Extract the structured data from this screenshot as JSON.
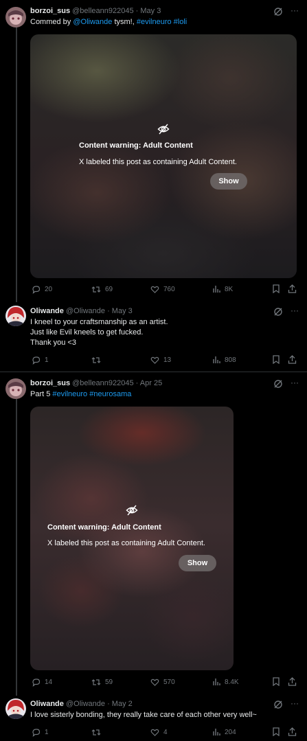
{
  "posts": [
    {
      "display_name": "borzoi_sus",
      "handle": "@belleann922045",
      "date": "· May 3",
      "text_prefix": "Commed by ",
      "mention": "@Oliwande",
      "text_mid": " tysm!, ",
      "tags": "#evilneuro #loli",
      "content_warning": {
        "title": "Content warning: Adult Content",
        "description": "X labeled this post as containing Adult Content.",
        "show_label": "Show"
      },
      "stats": {
        "replies": "20",
        "reposts": "69",
        "likes": "760",
        "views": "8K"
      }
    },
    {
      "display_name": "Oliwande",
      "handle": "@Oliwande",
      "date": "· May 3",
      "lines": [
        "I kneel to your craftsmanship as an artist.",
        "Just like Evil kneels to get fucked.",
        "Thank you <3"
      ],
      "stats": {
        "replies": "1",
        "reposts": "",
        "likes": "13",
        "views": "808"
      }
    },
    {
      "display_name": "borzoi_sus",
      "handle": "@belleann922045",
      "date": "· Apr 25",
      "text_prefix": "Part 5 ",
      "tags": "#evilneuro #neurosama",
      "content_warning": {
        "title": "Content warning: Adult Content",
        "description": "X labeled this post as containing Adult Content.",
        "show_label": "Show"
      },
      "stats": {
        "replies": "14",
        "reposts": "59",
        "likes": "570",
        "views": "8.4K"
      }
    },
    {
      "display_name": "Oliwande",
      "handle": "@Oliwande",
      "date": "· May 2",
      "text": "I love sisterly bonding, they really take care of each other very well~",
      "stats": {
        "replies": "1",
        "reposts": "",
        "likes": "4",
        "views": "204"
      }
    }
  ],
  "colors": {
    "link": "#1d9bf0",
    "muted": "#71767b",
    "text": "#e7e9ea",
    "background": "#000000"
  }
}
